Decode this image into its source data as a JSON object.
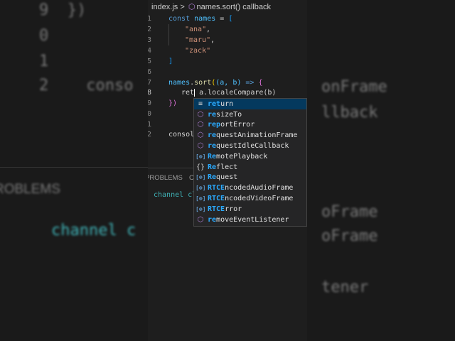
{
  "background": {
    "left": [
      "9  })",
      "0",
      "1",
      "2    conso",
      "ROBLEMS",
      "channel c"
    ],
    "right": [
      "onFrame",
      "llback",
      "oFrame",
      "oFrame",
      "tener"
    ]
  },
  "breadcrumb": {
    "file": "index.js",
    "separator": ">",
    "symbol": "names.sort() callback"
  },
  "lines": [
    "1",
    "2",
    "3",
    "4",
    "5",
    "6",
    "7",
    "8",
    "9",
    "0",
    "1",
    "2"
  ],
  "code": {
    "l1": {
      "kw": "const",
      "name": "names",
      "rest": " = ",
      "br": "["
    },
    "l2": "\"ana\"",
    "l3": "\"maru\"",
    "l4": "\"zack\"",
    "l5": "]",
    "l7": {
      "obj": "names",
      "dot": ".",
      "fn": "sort",
      "open": "(",
      "params": "(a, b)",
      "arrow": " => ",
      "brace": "{"
    },
    "l8": {
      "typed": "ret",
      "after": " a.localeCompare(b)"
    },
    "l9": "})",
    "l12": "consol"
  },
  "panel": {
    "problems": "PROBLEMS",
    "other": "C",
    "terminal": "channel cl"
  },
  "suggestions": [
    {
      "icon": "keyword",
      "match": "ret",
      "rest": "urn",
      "selected": true
    },
    {
      "icon": "method",
      "match": "re",
      "rest": "sizeTo"
    },
    {
      "icon": "method",
      "match": "rep",
      "rest": "ortError"
    },
    {
      "icon": "method",
      "match": "re",
      "rest": "questAnimationFrame"
    },
    {
      "icon": "method",
      "match": "re",
      "rest": "questIdleCallback"
    },
    {
      "icon": "field",
      "match": "Re",
      "rest": "motePlayback"
    },
    {
      "icon": "namespace",
      "match": "Re",
      "rest": "flect"
    },
    {
      "icon": "field",
      "match": "Re",
      "rest": "quest"
    },
    {
      "icon": "field",
      "match": "RTCE",
      "rest": "ncodedAudioFrame"
    },
    {
      "icon": "field",
      "match": "RTCE",
      "rest": "ncodedVideoFrame"
    },
    {
      "icon": "field",
      "match": "RTCE",
      "rest": "rror"
    },
    {
      "icon": "method",
      "match": "re",
      "rest": "moveEventListener"
    }
  ]
}
